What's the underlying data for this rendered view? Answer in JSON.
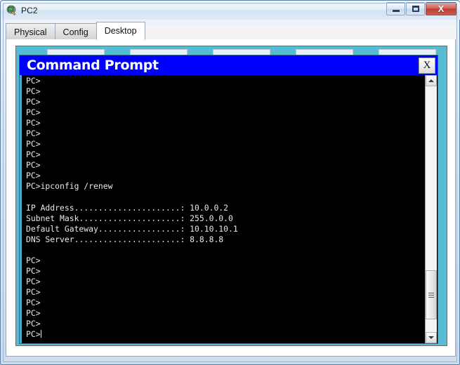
{
  "window": {
    "title": "PC2",
    "icon": "pc-device-icon",
    "controls": {
      "minimize_label": "–",
      "maximize_label": "□",
      "close_label": "X"
    }
  },
  "tabs": [
    {
      "label": "Physical",
      "active": false
    },
    {
      "label": "Config",
      "active": false
    },
    {
      "label": "Desktop",
      "active": true
    }
  ],
  "command_prompt": {
    "title": "Command Prompt",
    "close_label": "X",
    "lines": [
      "PC>",
      "PC>",
      "PC>",
      "PC>",
      "PC>",
      "PC>",
      "PC>",
      "PC>",
      "PC>",
      "PC>",
      "PC>ipconfig /renew",
      "",
      "IP Address......................: 10.0.0.2",
      "Subnet Mask.....................: 255.0.0.0",
      "Default Gateway.................: 10.10.10.1",
      "DNS Server......................: 8.8.8.8",
      "",
      "PC>",
      "PC>",
      "PC>",
      "PC>",
      "PC>",
      "PC>",
      "PC>",
      "PC>"
    ],
    "prompt_with_cursor": "PC>",
    "network_info": {
      "ip_address": "10.0.0.2",
      "subnet_mask": "255.0.0.0",
      "default_gateway": "10.10.10.1",
      "dns_server": "8.8.8.8",
      "command": "ipconfig /renew"
    },
    "scrollbar": {
      "up_arrow": "scroll-up-arrow-icon",
      "down_arrow": "scroll-down-arrow-icon"
    }
  },
  "colors": {
    "desktop_teal": "#55bcd4",
    "cmd_titlebar_blue": "#0000ff",
    "terminal_bg": "#000000",
    "terminal_text": "#e8e8e8",
    "close_button_red": "#b83e34"
  }
}
